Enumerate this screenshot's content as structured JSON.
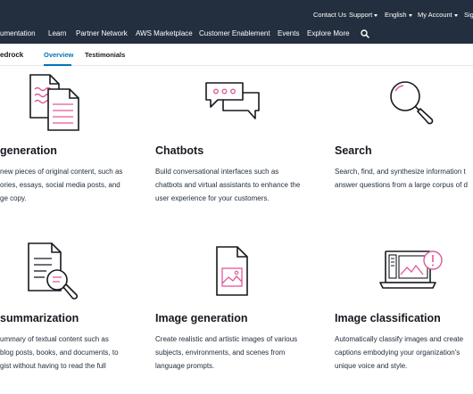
{
  "utility_nav": {
    "contact_us": "Contact Us",
    "support": "Support",
    "language": "English",
    "my_account": "My Account",
    "sign_in": "Sig"
  },
  "main_nav": {
    "items": [
      "umentation",
      "Learn",
      "Partner Network",
      "AWS Marketplace",
      "Customer Enablement",
      "Events",
      "Explore More"
    ]
  },
  "sub_nav": {
    "brand": "edrock",
    "tabs": [
      "Overview",
      "Testimonials"
    ],
    "active_tab": "Overview"
  },
  "features": [
    {
      "title": "generation",
      "description": "new pieces of original content, such as\nories, essays, social media posts, and\nge copy.",
      "icon": "document-generation-icon"
    },
    {
      "title": "Chatbots",
      "description": "Build conversational interfaces such as\nchatbots and virtual assistants to enhance the\nuser experience for your customers.",
      "icon": "chat-bubbles-icon"
    },
    {
      "title": "Search",
      "description": "Search, find, and synthesize information t\nanswer questions from a large corpus of d",
      "icon": "magnifying-glass-icon"
    },
    {
      "title": "summarization",
      "description": "ummary of textual content such as\nblog posts, books, and documents, to\ngist without having to read the full",
      "icon": "document-search-icon"
    },
    {
      "title": "Image generation",
      "description": "Create realistic and artistic images of various\nsubjects, environments, and scenes from\nlanguage prompts.",
      "icon": "image-file-icon"
    },
    {
      "title": "Image classification",
      "description": "Automatically classify images and create\ncaptions embodying your organization's\nunique voice and style.",
      "icon": "laptop-alert-icon"
    }
  ],
  "colors": {
    "nav_bg": "#232f3e",
    "accent": "#0073bb",
    "icon_pink": "#e0579d"
  }
}
